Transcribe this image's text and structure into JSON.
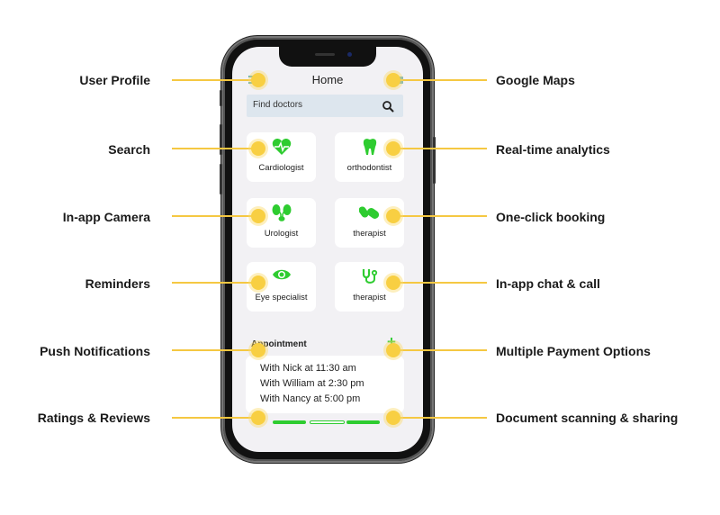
{
  "features_left": [
    {
      "label": "User Profile"
    },
    {
      "label": "Search"
    },
    {
      "label": "In-app Camera"
    },
    {
      "label": "Reminders"
    },
    {
      "label": "Push Notifications"
    },
    {
      "label": "Ratings & Reviews"
    }
  ],
  "features_right": [
    {
      "label": "Google Maps"
    },
    {
      "label": "Real-time analytics"
    },
    {
      "label": "One-click booking"
    },
    {
      "label": "In-app chat & call"
    },
    {
      "label": "Multiple Payment Options"
    },
    {
      "label": "Document scanning & sharing"
    }
  ],
  "app": {
    "title": "Home",
    "menu_icon": "hamburger-menu-icon",
    "map_icon": "map-icon",
    "search": {
      "placeholder": "Find doctors",
      "icon": "search-icon"
    },
    "specialties": [
      {
        "name": "Cardiologist",
        "icon": "heart-pulse-icon"
      },
      {
        "name": "orthodontist",
        "icon": "tooth-icon"
      },
      {
        "name": "Urologist",
        "icon": "kidneys-icon"
      },
      {
        "name": "therapist",
        "icon": "pills-icon"
      },
      {
        "name": "Eye specialist",
        "icon": "eye-icon"
      },
      {
        "name": "therapist",
        "icon": "stethoscope-icon"
      }
    ],
    "appointment": {
      "title": "Appointment",
      "add_label": "+",
      "items": [
        "With Nick at 11:30 am",
        "With William at 2:30 pm",
        "With Nancy at 5:00 pm"
      ]
    },
    "pager": {
      "pages": 3,
      "active": 2
    }
  },
  "colors": {
    "accent_green": "#2ecc30",
    "highlight_yellow": "#f8cf42",
    "screen_bg": "#f2f1f4"
  }
}
